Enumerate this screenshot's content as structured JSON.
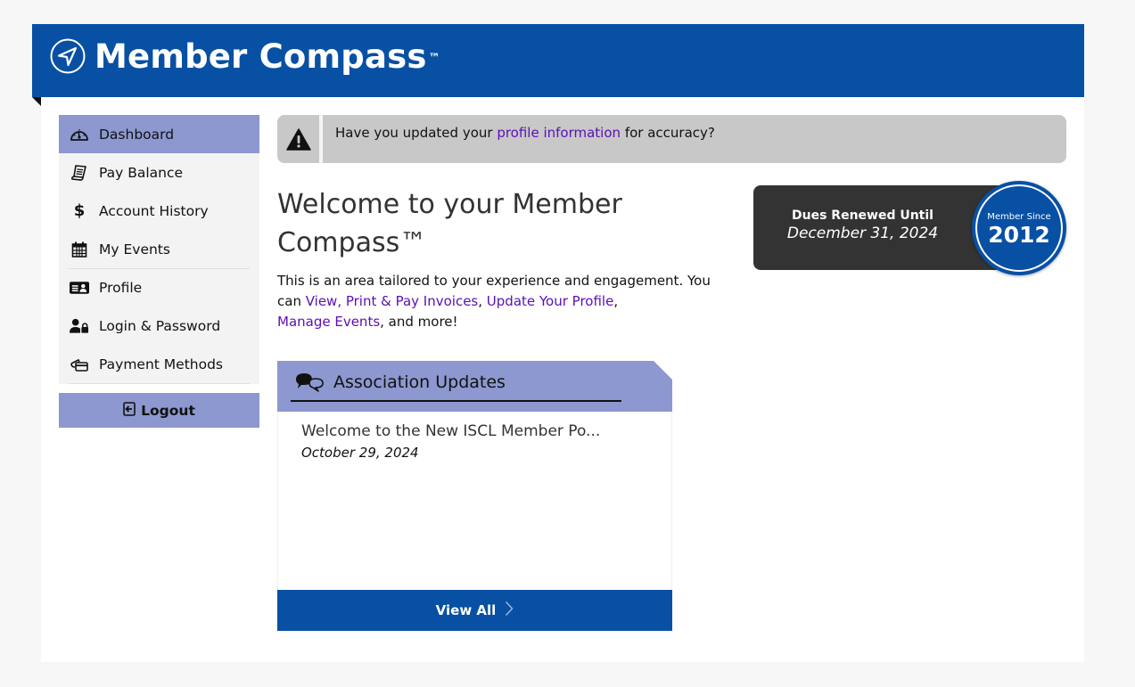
{
  "header": {
    "app_title": "Member Compass",
    "trademark": "™",
    "logo_icon": "compass-navigation-icon"
  },
  "sidebar": {
    "items": [
      {
        "label": "Dashboard",
        "icon": "speedometer-icon",
        "active": true
      },
      {
        "label": "Pay Balance",
        "icon": "receipt-icon",
        "active": false
      },
      {
        "label": "Account History",
        "icon": "dollar-icon",
        "active": false
      },
      {
        "label": "My Events",
        "icon": "calendar-icon",
        "active": false
      },
      {
        "label": "Profile",
        "icon": "id-card-icon",
        "active": false
      },
      {
        "label": "Login & Password",
        "icon": "user-lock-icon",
        "active": false
      },
      {
        "label": "Payment Methods",
        "icon": "credit-cards-icon",
        "active": false
      }
    ],
    "logout_label": "Logout"
  },
  "alert": {
    "icon": "warning-triangle-icon",
    "text_before": "Have you updated your ",
    "link_text": "profile information",
    "text_after": " for accuracy?"
  },
  "welcome": {
    "title": "Welcome to your Member Compass™",
    "intro": "This is an area tailored to your experience and engagement. You can ",
    "link_invoices": "View, Print & Pay Invoices",
    "sep1": ", ",
    "link_profile": "Update Your Profile",
    "sep2": ", ",
    "link_events": "Manage Events",
    "outro": ", and more!"
  },
  "dues": {
    "label": "Dues Renewed Until",
    "date": "December 31, 2024"
  },
  "member_since": {
    "label": "Member Since",
    "year": "2012"
  },
  "updates": {
    "title": "Association Updates",
    "icon": "speech-bubbles-icon",
    "items": [
      {
        "title": "Welcome to the New ISCL Member Po...",
        "date": "October 29, 2024"
      }
    ],
    "view_all_label": "View All"
  },
  "colors": {
    "brand_blue": "#0850a4",
    "nav_active": "#8c98cf",
    "link_purple": "#5b0fb5",
    "dues_bg": "#333333",
    "alert_bg": "#c8c8c8"
  }
}
